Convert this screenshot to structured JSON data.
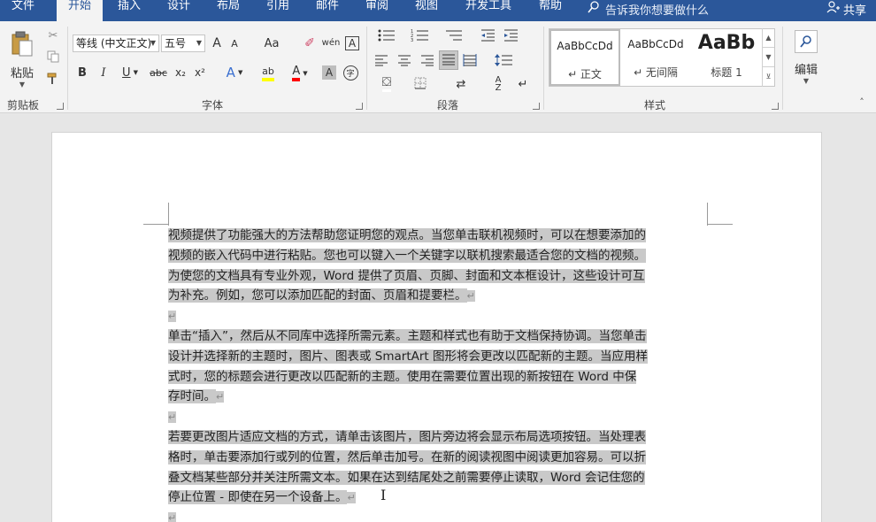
{
  "tabs": [
    {
      "label": "文件",
      "active": false
    },
    {
      "label": "开始",
      "active": true
    },
    {
      "label": "插入",
      "active": false
    },
    {
      "label": "设计",
      "active": false
    },
    {
      "label": "布局",
      "active": false
    },
    {
      "label": "引用",
      "active": false
    },
    {
      "label": "邮件",
      "active": false
    },
    {
      "label": "审阅",
      "active": false
    },
    {
      "label": "视图",
      "active": false
    },
    {
      "label": "开发工具",
      "active": false
    },
    {
      "label": "帮助",
      "active": false
    }
  ],
  "tell_me": "告诉我你想要做什么",
  "share": "共享",
  "clipboard": {
    "paste_label": "粘贴",
    "group_label": "剪贴板"
  },
  "font": {
    "font_name": "等线 (中文正文)",
    "font_size": "五号",
    "grow": "A",
    "shrink": "A",
    "change_case": "Aa",
    "phonetic": "wén",
    "bold": "B",
    "italic": "I",
    "underline": "U",
    "strike": "abc",
    "subscript": "x₂",
    "superscript": "x²",
    "text_effect": "A",
    "highlight": "ab",
    "font_color": "A",
    "char_shading": "A",
    "enclose": "字",
    "group_label": "字体"
  },
  "paragraph": {
    "group_label": "段落"
  },
  "styles": {
    "items": [
      {
        "sample": "AaBbCcDd",
        "name": "↵ 正文"
      },
      {
        "sample": "AaBbCcDd",
        "name": "↵ 无间隔"
      },
      {
        "sample": "AaBb",
        "name": "标题 1"
      }
    ],
    "group_label": "样式"
  },
  "editing": {
    "label": "编辑"
  },
  "document": {
    "paragraphs": [
      [
        "视频提供了功能强大的方法帮助您证明您的观点。当您单击联机视频时，可以在想要添加的",
        "视频的嵌入代码中进行粘贴。您也可以键入一个关键字以联机搜索最适合您的文档的视频。",
        "为使您的文档具有专业外观，Word 提供了页眉、页脚、封面和文本框设计，这些设计可互",
        "为补充。例如，您可以添加匹配的封面、页眉和提要栏。"
      ],
      [
        "单击“插入”，然后从不同库中选择所需元素。主题和样式也有助于文档保持协调。当您单击",
        "设计并选择新的主题时，图片、图表或 SmartArt 图形将会更改以匹配新的主题。当应用样",
        "式时，您的标题会进行更改以匹配新的主题。使用在需要位置出现的新按钮在 Word 中保",
        "存时间。"
      ],
      [
        "若要更改图片适应文档的方式，请单击该图片，图片旁边将会显示布局选项按钮。当处理表",
        "格时，单击要添加行或列的位置，然后单击加号。在新的阅读视图中阅读更加容易。可以折",
        "叠文档某些部分并关注所需文本。如果在达到结尾处之前需要停止读取，Word 会记住您的",
        "停止位置 - 即使在另一个设备上。"
      ]
    ],
    "paragraph_mark": "↵"
  },
  "colors": {
    "tab_bar": "#2b579a",
    "ribbon": "#f3f3f3",
    "selection": "#c9c9c9",
    "highlight_yellow": "#ffff00",
    "font_red": "#ff0000"
  }
}
